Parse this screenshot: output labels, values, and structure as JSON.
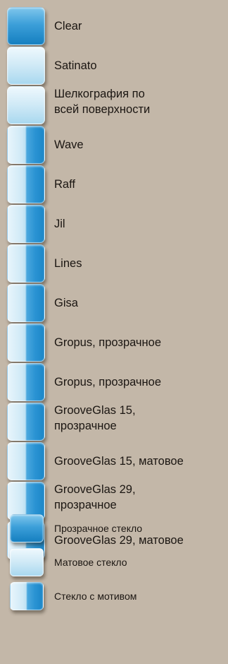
{
  "items": [
    {
      "label": "Clear",
      "type": "clear"
    },
    {
      "label": "Satinato",
      "type": "frosted"
    },
    {
      "label": "Шелкография по\nвсей поверхности",
      "type": "frosted"
    },
    {
      "label": "Wave",
      "type": "pattern"
    },
    {
      "label": "Raff",
      "type": "pattern"
    },
    {
      "label": "Jil",
      "type": "pattern"
    },
    {
      "label": "Lines",
      "type": "pattern"
    },
    {
      "label": "Gisa",
      "type": "pattern"
    },
    {
      "label": "Gropus, прозрачное",
      "type": "pattern"
    },
    {
      "label": "Gropus, прозрачное",
      "type": "pattern"
    },
    {
      "label": "GrooveGlas 15,\nпрозрачное",
      "type": "pattern"
    },
    {
      "label": "GrooveGlas 15, матовое",
      "type": "pattern"
    },
    {
      "label": "GrooveGlas 29,\nпрозрачное",
      "type": "pattern"
    },
    {
      "label": "GrooveGlas 29, матовое",
      "type": "pattern"
    }
  ],
  "legend": [
    {
      "label": "Прозрачное стекло",
      "type": "clear"
    },
    {
      "label": "Матовое стекло",
      "type": "frosted"
    },
    {
      "label": "Стекло с мотивом",
      "type": "pattern"
    }
  ],
  "colors": {
    "background": "#c3b7a8",
    "clear_glass": "#2a93d3",
    "frosted_glass": "#cfe9f6"
  }
}
